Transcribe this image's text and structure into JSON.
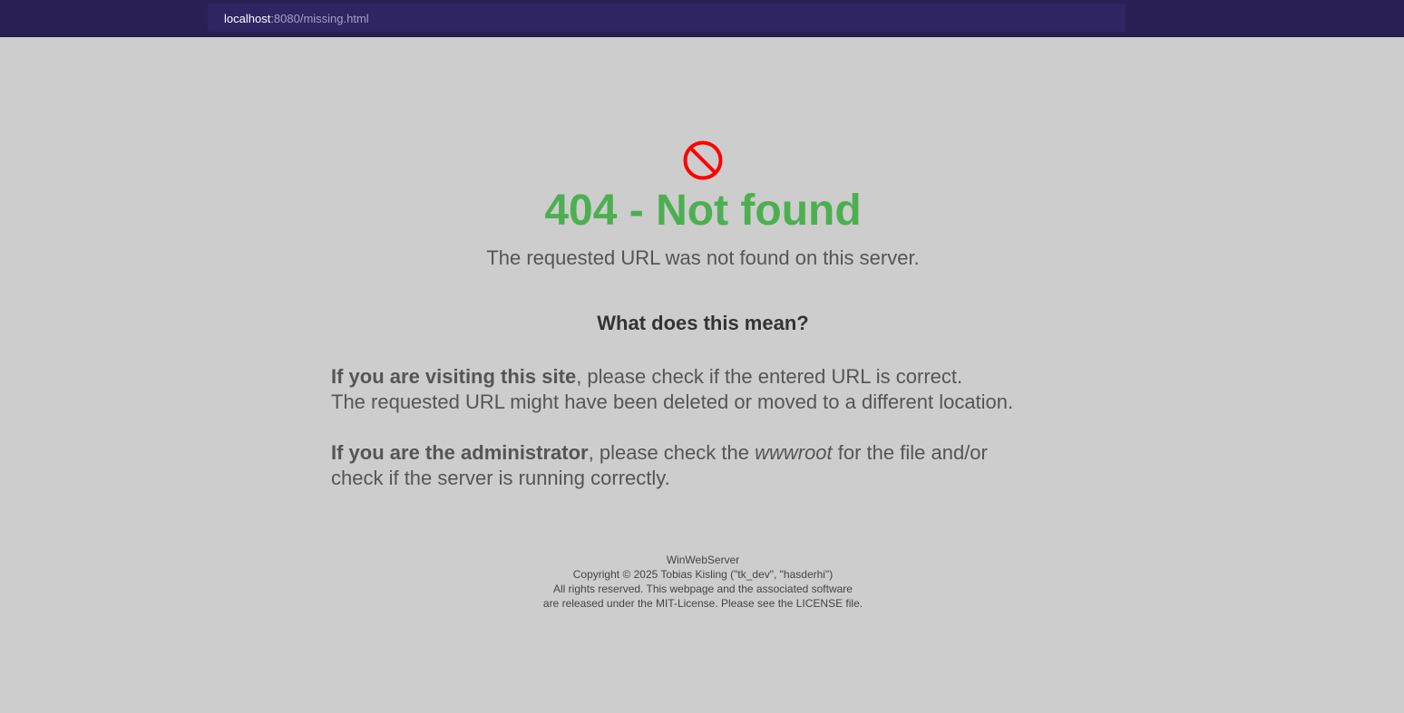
{
  "browser": {
    "url_host": "localhost",
    "url_rest": ":8080/missing.html"
  },
  "page": {
    "icon": "prohibited-icon",
    "title": "404 - Not found",
    "subtitle": "The requested URL was not found on this server.",
    "question": "What does this mean?",
    "visitor": {
      "lead": "If you are visiting this site",
      "line1_rest": ", please check if the entered URL is correct.",
      "line2": "The requested URL might have been deleted or moved to a different location."
    },
    "admin": {
      "lead": "If you are the administrator",
      "text_before": ", please check the ",
      "emphasis": "wwwroot",
      "text_after": " for the file and/or",
      "line2": "check if the server is running correctly."
    }
  },
  "footer": {
    "line1": "WinWebServer",
    "line2": "Copyright © 2025 Tobias Kisling (\"tk_dev\", \"hasderhi\")",
    "line3": "All rights reserved. This webpage and the associated software",
    "line4": "are released under the MIT-License. Please see the LICENSE file."
  },
  "colors": {
    "topbar": "#2a1f55",
    "urlbar": "#2f2563",
    "background": "#cdcdcd",
    "title": "#4caf50",
    "icon": "#ff0000",
    "text": "#555555"
  }
}
